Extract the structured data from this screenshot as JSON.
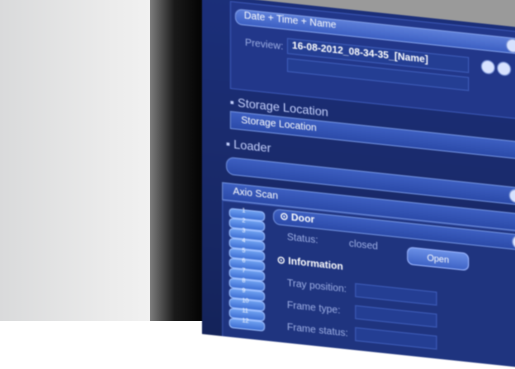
{
  "naming": {
    "pattern": "Date + Time + Name",
    "preview_label": "Preview:",
    "preview_value": "16-08-2012_08-34-35_[Name]"
  },
  "sections": {
    "storage_location_heading": "Storage Location",
    "storage_location_bar": "Storage Location",
    "loader_heading": "Loader",
    "axio_scan_tab": "Axio Scan"
  },
  "door": {
    "title": "Door",
    "status_label": "Status:",
    "status_value": "closed",
    "open_button": "Open"
  },
  "information": {
    "title": "Information",
    "tray_position_label": "Tray position:",
    "frame_type_label": "Frame type:",
    "frame_status_label": "Frame status:"
  },
  "tray_slots": [
    "1",
    "2",
    "3",
    "4",
    "5",
    "6",
    "7",
    "8",
    "9",
    "10",
    "11",
    "12"
  ],
  "colors": {
    "screen": "#1a2b6d",
    "accent": "#5d7fd9",
    "text": "#ffffff"
  }
}
